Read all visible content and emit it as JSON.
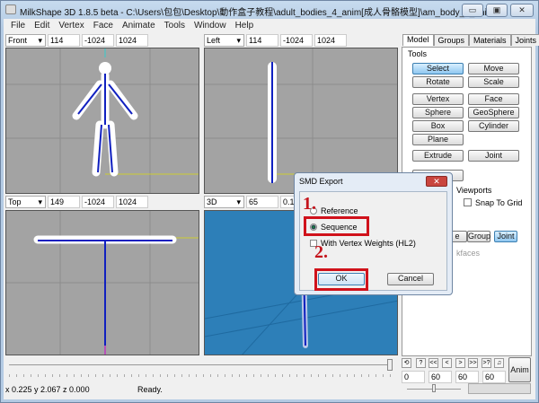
{
  "window": {
    "title": "MilkShape 3D 1.8.5 beta - C:\\Users\\包包\\Desktop\\動作盒子教程\\adult_bodies_4_anim[成人骨骼模型]\\am_body_4_anim...",
    "minimize": "▭",
    "maximize": "▣",
    "close": "✕"
  },
  "menu": [
    "File",
    "Edit",
    "Vertex",
    "Face",
    "Animate",
    "Tools",
    "Window",
    "Help"
  ],
  "viewports": [
    {
      "view": "Front",
      "a": "114",
      "b": "-1024",
      "c": "1024"
    },
    {
      "view": "Left",
      "a": "114",
      "b": "-1024",
      "c": "1024"
    },
    {
      "view": "Top",
      "a": "149",
      "b": "-1024",
      "c": "1024"
    },
    {
      "view": "3D",
      "a": "65",
      "b": "0.1",
      "c": ""
    }
  ],
  "tabs": [
    "Model",
    "Groups",
    "Materials",
    "Joints"
  ],
  "tools": {
    "heading": "Tools",
    "buttons": [
      "Select",
      "Move",
      "Rotate",
      "Scale",
      "Vertex",
      "Face",
      "Sphere",
      "GeoSphere",
      "Box",
      "Cylinder",
      "Plane",
      "Extrude",
      "Joint"
    ],
    "viewports_label": "Viewports",
    "snap_to_grid": "Snap To Grid",
    "sel_buttons": [
      "e",
      "Group",
      "Joint"
    ],
    "backfaces": "kfaces"
  },
  "dialog": {
    "title": "SMD Export",
    "reference": "Reference",
    "sequence": "Sequence",
    "weights": "With Vertex Weights (HL2)",
    "ok": "OK",
    "cancel": "Cancel",
    "step1": "1.",
    "step2": "2."
  },
  "anim": {
    "buttons": [
      "⟲",
      "?",
      "<<",
      "<",
      ">",
      ">>",
      ">?",
      "♫"
    ],
    "fields": [
      "0",
      "60",
      "60",
      "60"
    ],
    "anim_label": "Anim"
  },
  "status": {
    "coords": "x 0.225 y 2.067 z 0.000",
    "message": "Ready."
  }
}
